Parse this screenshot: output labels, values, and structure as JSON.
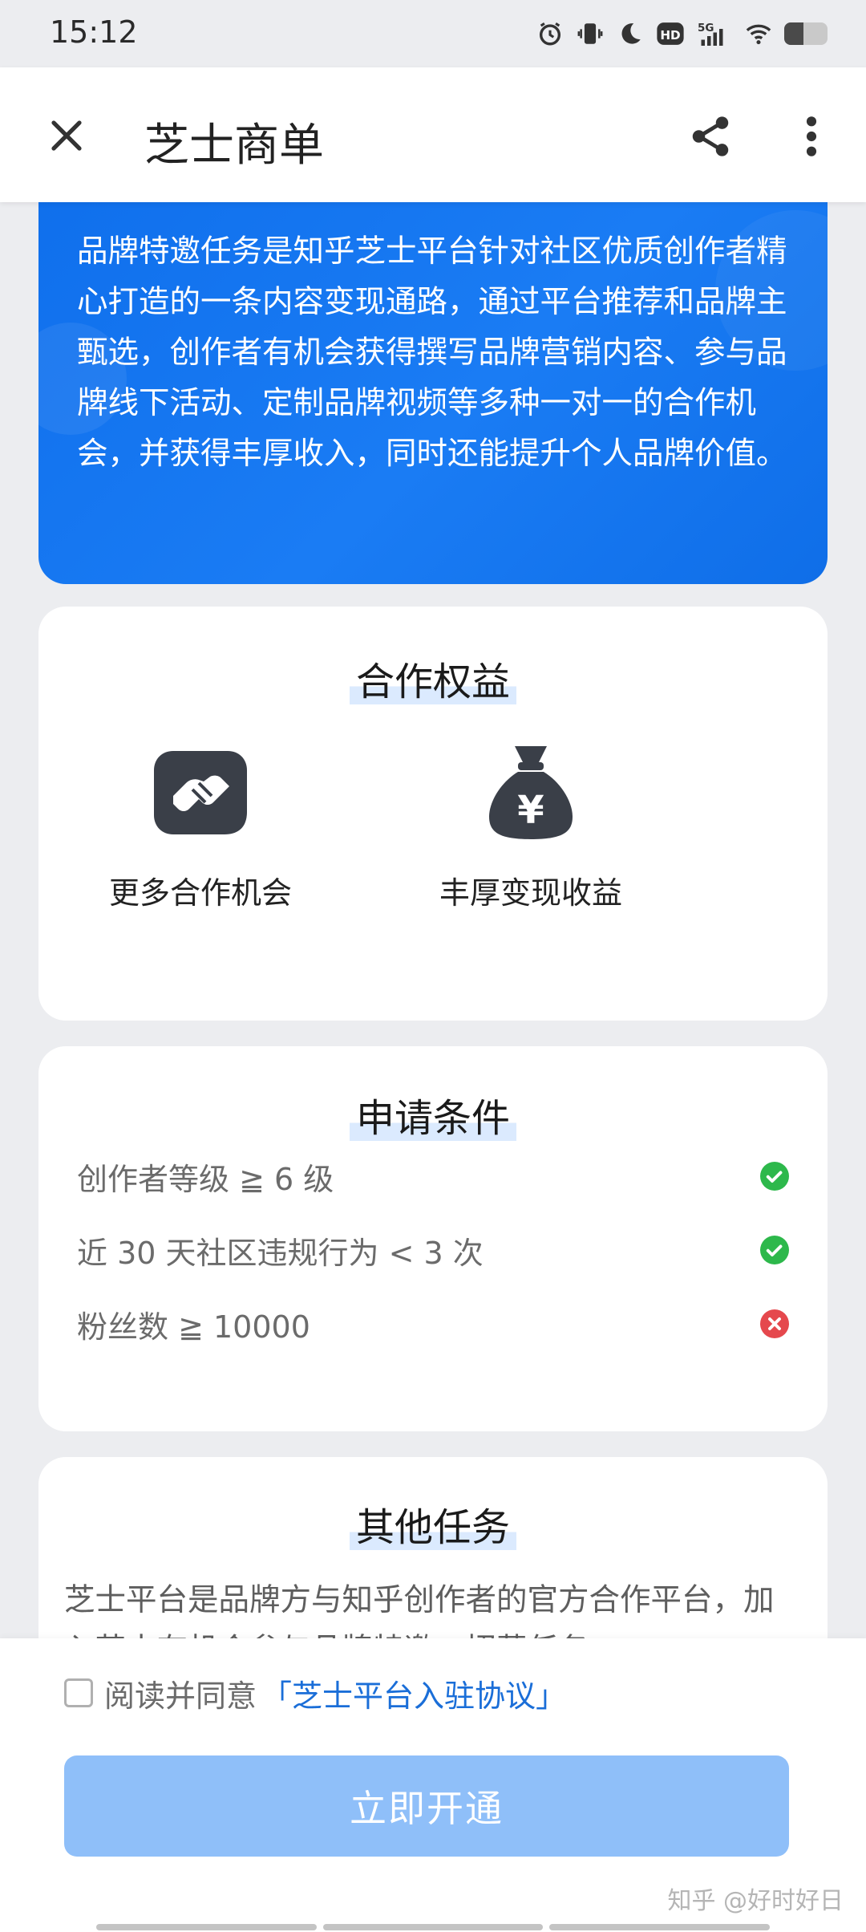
{
  "status_bar": {
    "time": "15:12",
    "icons": [
      "alarm-icon",
      "vibrate-icon",
      "moon-icon",
      "hd-icon",
      "signal-5g-icon",
      "wifi-icon",
      "battery-icon"
    ],
    "hd_label": "HD",
    "network_label": "5G"
  },
  "app_bar": {
    "title": "芝士商单",
    "icons": [
      "close-icon",
      "share-icon",
      "more-vertical-icon"
    ]
  },
  "intro": {
    "text": "品牌特邀任务是知乎芝士平台针对社区优质创作者精心打造的一条内容变现通路，通过平台推荐和品牌主甄选，创作者有机会获得撰写品牌营销内容、参与品牌线下活动、定制品牌视频等多种一对一的合作机会，并获得丰厚收入，同时还能提升个人品牌价值。"
  },
  "benefits": {
    "title": "合作权益",
    "items": [
      {
        "icon": "handshake-icon",
        "label": "更多合作机会"
      },
      {
        "icon": "money-bag-icon",
        "label": "丰厚变现收益",
        "icon_glyph": "¥"
      }
    ]
  },
  "requirements": {
    "title": "申请条件",
    "items": [
      {
        "text": "创作者等级 ≧ 6 级",
        "status": "met",
        "icon": "check-circle-icon"
      },
      {
        "text": "近 30 天社区违规行为 < 3 次",
        "status": "met",
        "icon": "check-circle-icon"
      },
      {
        "text": "粉丝数 ≧ 10000",
        "status": "not-met",
        "icon": "cross-circle-icon"
      }
    ]
  },
  "other_tasks": {
    "title": "其他任务",
    "text": "芝士平台是品牌方与知乎创作者的官方合作平台，加入芝士有机会参与品牌特邀、招募任务"
  },
  "bottom": {
    "agree_text": "阅读并同意",
    "agree_link": "「芝士平台入驻协议」",
    "agree_checked": false,
    "button_label": "立即开通",
    "watermark": "知乎 @好时好日"
  },
  "colors": {
    "intro_blue": "#1a7cf4",
    "button_blue": "#8fbff9",
    "link_blue": "#1a6ed8",
    "success_green": "#2db84b",
    "error_red": "#e5484d"
  }
}
